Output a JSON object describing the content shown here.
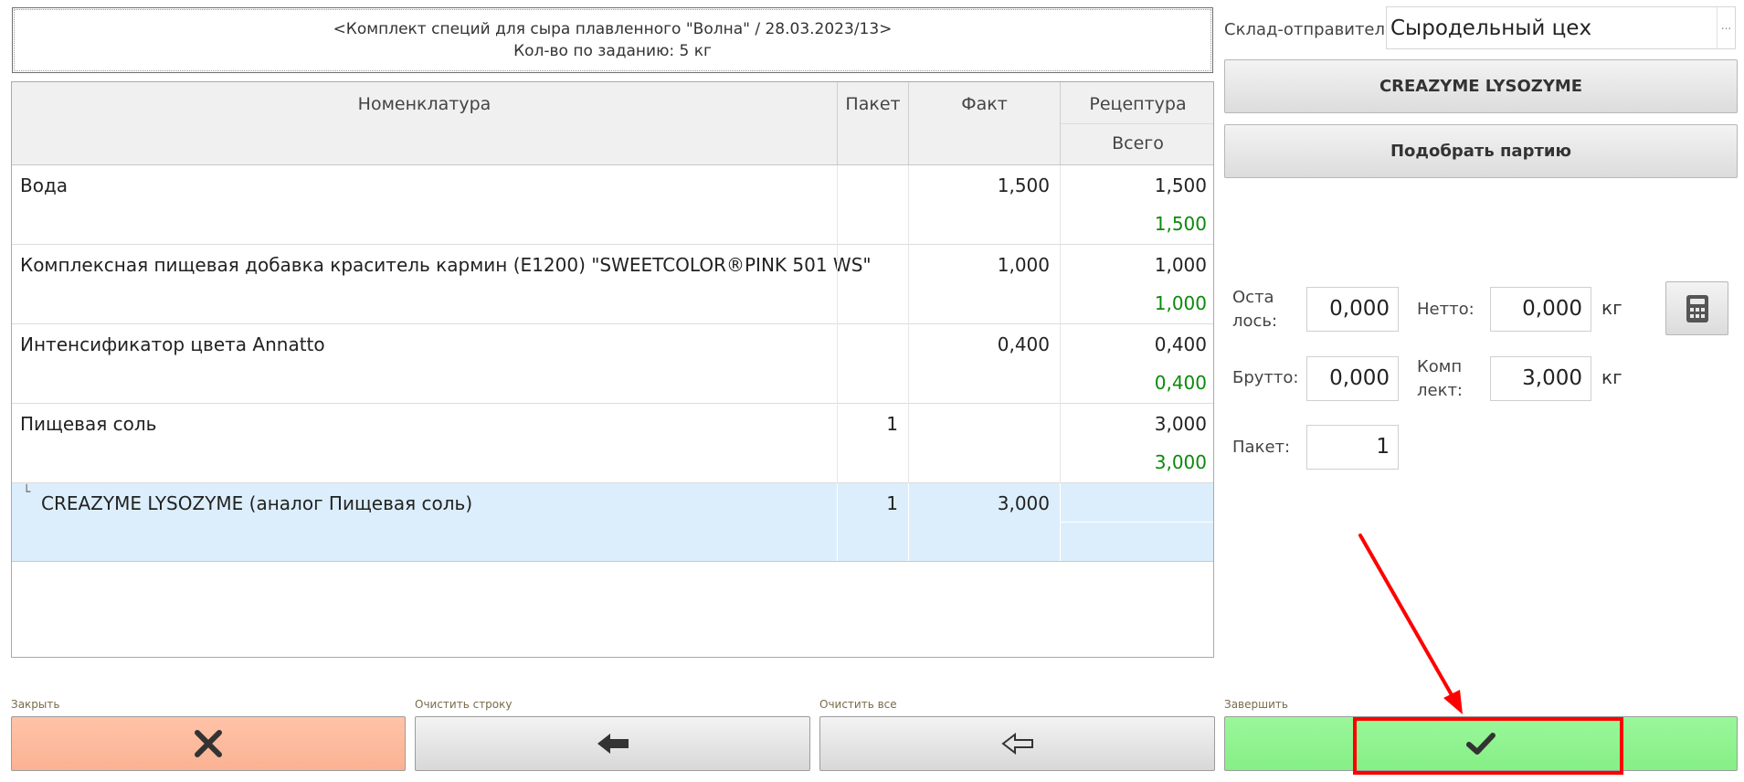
{
  "header": {
    "line1": "<Комплект специй для сыра плавленного \"Волна\" / 28.03.2023/13>",
    "line2": "Кол-во по заданию: 5 кг"
  },
  "table": {
    "headers": {
      "name": "Номенклатура",
      "packet": "Пакет",
      "fact": "Факт",
      "recipe": "Рецептура",
      "total": "Всего"
    },
    "rows": [
      {
        "name": "Вода",
        "packet": "",
        "fact": "1,500",
        "total": "1,500",
        "total2": "1,500"
      },
      {
        "name": "Комплексная пищевая добавка краситель кармин (Е1200) \"SWEETCOLOR®PINK 501 WS\"",
        "packet": "",
        "fact": "1,000",
        "total": "1,000",
        "total2": "1,000"
      },
      {
        "name": "Интенсификатор цвета Annatto",
        "packet": "",
        "fact": "0,400",
        "total": "0,400",
        "total2": "0,400"
      },
      {
        "name": "Пищевая соль",
        "packet": "1",
        "fact": "",
        "total": "3,000",
        "total2": "3,000"
      },
      {
        "name": "CREAZYME LYSOZYME (аналог Пищевая соль)",
        "packet": "1",
        "fact": "3,000",
        "total": "",
        "total2": "",
        "child_marker": "└"
      }
    ]
  },
  "right": {
    "warehouse_label": "Склад-отправитель:",
    "warehouse_value": "Сыродельный цех",
    "warehouse_more": "...",
    "product_button": "CREAZYME LYSOZYME",
    "batch_button": "Подобрать партию",
    "remain_label": "Оста лось:",
    "remain_value": "0,000",
    "netto_label": "Нетто:",
    "netto_value": "0,000",
    "netto_unit": "кг",
    "brutto_label": "Брутто:",
    "brutto_value": "0,000",
    "komplekt_label": "Комп лект:",
    "komplekt_value": "3,000",
    "komplekt_unit": "кг",
    "packet_label": "Пакет:",
    "packet_value": "1"
  },
  "footer": {
    "close_label": "Закрыть",
    "clear_row_label": "Очистить строку",
    "clear_all_label": "Очистить все",
    "finish_label": "Завершить"
  },
  "colors": {
    "close_bg": "#ffbfa4",
    "finish_bg": "#8ef58e",
    "highlight_row": "#dceefc",
    "green_text": "#0b8a0b",
    "annotation_red": "#ff0000"
  }
}
